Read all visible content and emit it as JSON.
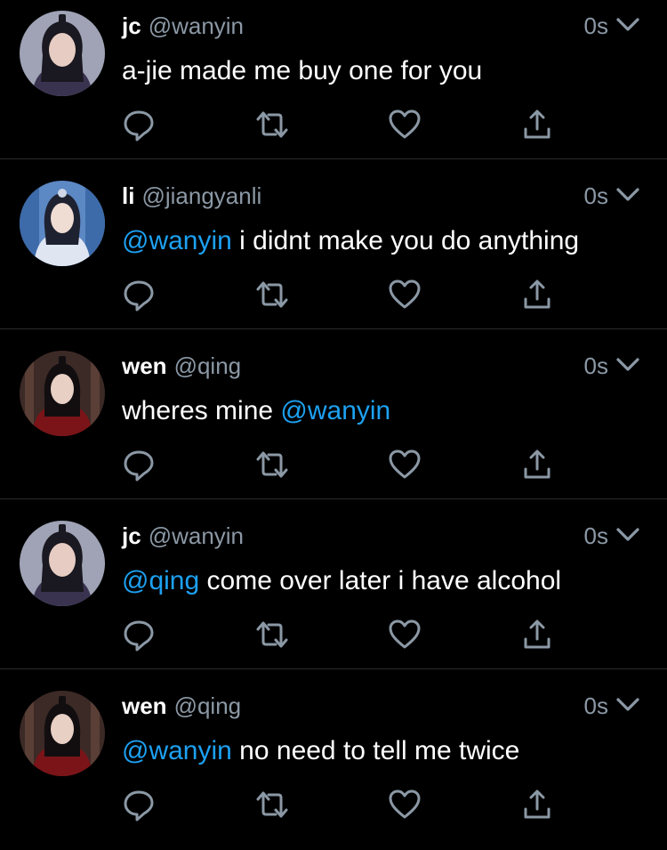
{
  "tweets": [
    {
      "name": "jc",
      "handle": "@wanyin",
      "time": "0s",
      "mention": "",
      "text": "a-jie made me buy one for you",
      "avatar": "portrait of man with long dark hair and topknot",
      "avatar_colors": {
        "bg": "#9fa3b5",
        "hair": "#1a1820",
        "skin": "#e6ccc2",
        "robe": "#3a3350"
      }
    },
    {
      "name": "li",
      "handle": "@jiangyanli",
      "time": "0s",
      "mention": "@wanyin",
      "text": " i didnt make you do anything",
      "avatar": "portrait of woman in white and blue robes",
      "avatar_colors": {
        "bg": "#5c88c4",
        "hair": "#1e2230",
        "skin": "#efdcd3",
        "robe": "#dfe6f2"
      }
    },
    {
      "name": "wen",
      "handle": "@qing",
      "time": "0s",
      "mention": "",
      "text": "wheres mine ",
      "trailing_mention": "@wanyin",
      "avatar": "portrait of woman in dark red robes",
      "avatar_colors": {
        "bg": "#3c2a26",
        "hair": "#120e10",
        "skin": "#e8d0c4",
        "robe": "#7a1418"
      }
    },
    {
      "name": "jc",
      "handle": "@wanyin",
      "time": "0s",
      "mention": "@qing",
      "text": " come over later i have alcohol",
      "avatar": "portrait of man with long dark hair and topknot",
      "avatar_colors": {
        "bg": "#9fa3b5",
        "hair": "#1a1820",
        "skin": "#e6ccc2",
        "robe": "#3a3350"
      }
    },
    {
      "name": "wen",
      "handle": "@qing",
      "time": "0s",
      "mention": "@wanyin",
      "text": " no need to tell me twice",
      "avatar": "portrait of woman in dark red robes",
      "avatar_colors": {
        "bg": "#3c2a26",
        "hair": "#120e10",
        "skin": "#e8d0c4",
        "robe": "#7a1418"
      }
    }
  ],
  "icons": {
    "reply": "reply-icon",
    "retweet": "retweet-icon",
    "like": "heart-icon",
    "share": "share-icon",
    "menu": "chevron-down-icon"
  },
  "colors": {
    "background": "#000000",
    "text": "#ffffff",
    "secondary": "#8b98a5",
    "mention": "#1da1f2",
    "divider": "#2a2a2e"
  }
}
